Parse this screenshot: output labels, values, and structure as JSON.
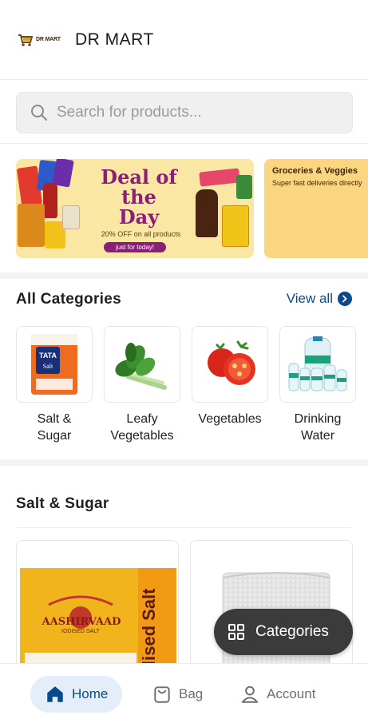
{
  "header": {
    "logo_text": "DR MART",
    "title": "DR MART"
  },
  "search": {
    "placeholder": "Search for products..."
  },
  "banners": [
    {
      "title": "Deal of the Day",
      "subtitle": "20% OFF on all products",
      "pill": "just for today!",
      "color": "#fbe7a4",
      "accent": "#8a1f7a"
    },
    {
      "title": "Groceries & Veggies",
      "subtitle": "Super fast deliveries directly",
      "color": "#fcd580"
    }
  ],
  "categories": {
    "title": "All Categories",
    "view_all": "View all",
    "items": [
      {
        "label": "Salt & Sugar",
        "icon": "salt-pack-icon"
      },
      {
        "label": "Leafy Vegetables",
        "icon": "leafy-greens-icon"
      },
      {
        "label": "Vegetables",
        "icon": "tomato-icon"
      },
      {
        "label": "Drinking Water",
        "icon": "water-bottles-icon"
      }
    ]
  },
  "salt_section": {
    "title": "Salt & Sugar",
    "products": [
      {
        "brand": "AASHIRVAAD",
        "side_text": "Iodised Salt",
        "sub": "IODISED SALT"
      },
      {
        "brand": "",
        "side_text": ""
      }
    ]
  },
  "fab": {
    "label": "Categories"
  },
  "bottom_nav": {
    "home": "Home",
    "bag": "Bag",
    "account": "Account"
  },
  "colors": {
    "brand_blue": "#0a4a8c",
    "active_pill": "#e4eef9",
    "fab_bg": "#3b3b3b"
  }
}
